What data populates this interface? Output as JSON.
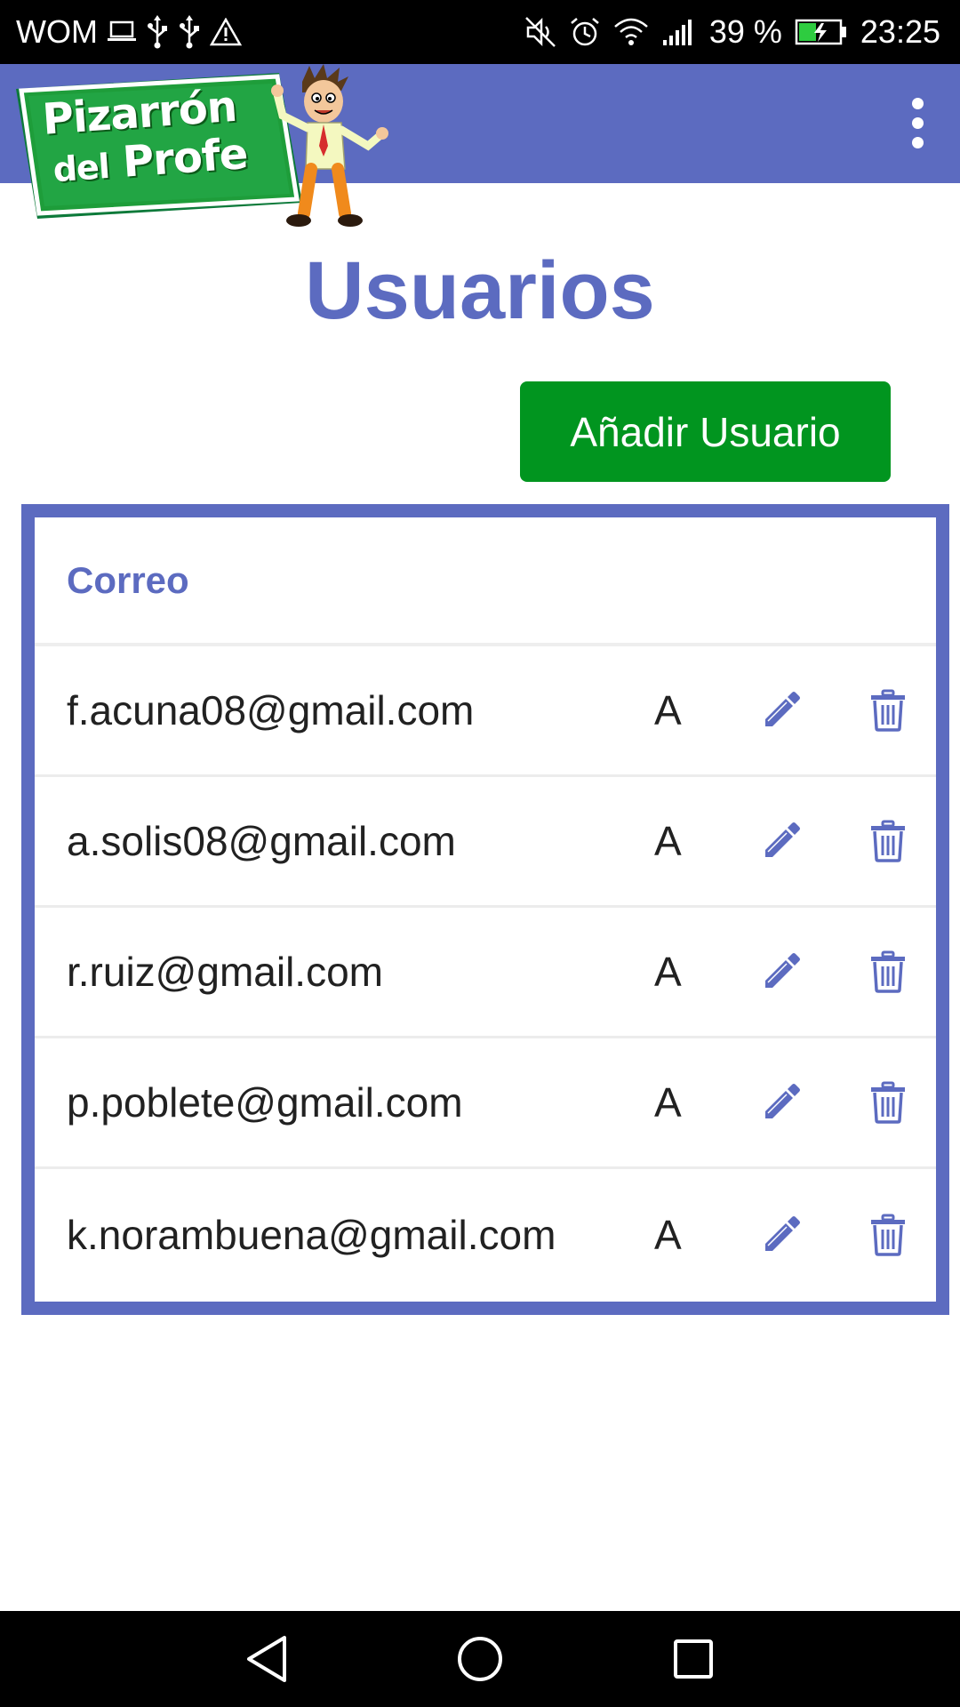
{
  "status_bar": {
    "carrier": "WOM",
    "battery_percent": "39 %",
    "time": "23:25",
    "icons_left": [
      "laptop-icon",
      "usb-icon",
      "usb-icon",
      "warning-icon"
    ],
    "icons_right": [
      "mute-icon",
      "alarm-icon",
      "wifi-icon",
      "signal-icon",
      "battery-charging-icon"
    ]
  },
  "app_bar": {
    "logo": {
      "line1": "Pizarrón",
      "line2_small": "del",
      "line2_big": "Profe"
    },
    "menu_icon": "more-vert-icon"
  },
  "page": {
    "title": "Usuarios",
    "add_button_label": "Añadir Usuario"
  },
  "table": {
    "header_email": "Correo",
    "rows": [
      {
        "email": "f.acuna08@gmail.com",
        "role": "A"
      },
      {
        "email": "a.solis08@gmail.com",
        "role": "A"
      },
      {
        "email": "r.ruiz@gmail.com",
        "role": "A"
      },
      {
        "email": "p.poblete@gmail.com",
        "role": "A"
      },
      {
        "email": "k.norambuena@gmail.com",
        "role": "A"
      }
    ],
    "row_icons": {
      "edit": "pencil-icon",
      "delete": "trash-icon"
    }
  },
  "nav_bar": {
    "icons": [
      "back-icon",
      "home-icon",
      "recents-icon"
    ]
  },
  "colors": {
    "primary": "#5c6bc0",
    "accent_button": "#01951f",
    "status_bar": "#000000",
    "text": "#212121"
  }
}
